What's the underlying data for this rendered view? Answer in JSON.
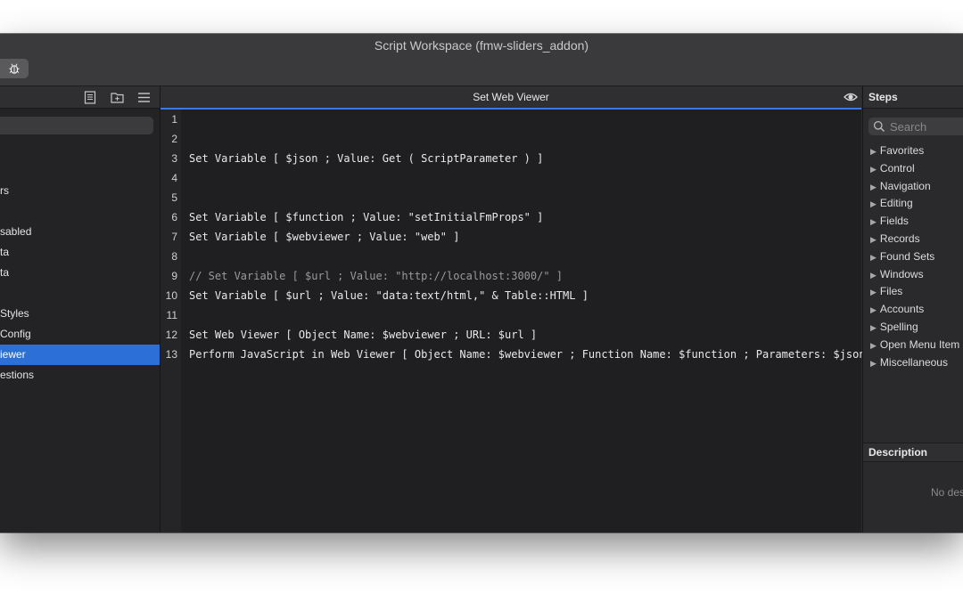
{
  "window": {
    "title": "Script Workspace (fmw-sliders_addon)"
  },
  "toolbar": {
    "debug_icon": "bug-icon"
  },
  "scripts_pane": {
    "search_placeholder": "",
    "items": [
      {
        "label": ""
      },
      {
        "label": ""
      },
      {
        "label": "rs"
      },
      {
        "label": ""
      },
      {
        "label": "sabled"
      },
      {
        "label": "ta"
      },
      {
        "label": "ta"
      },
      {
        "label": ""
      },
      {
        "label": "Styles"
      },
      {
        "label": "Config"
      },
      {
        "label": "iewer",
        "selected": true
      },
      {
        "label": "estions"
      }
    ]
  },
  "editor": {
    "title": "Set Web Viewer",
    "lines": [
      {
        "no": "1",
        "text": ""
      },
      {
        "no": "2",
        "text": ""
      },
      {
        "no": "3",
        "text": "Set Variable [ $json ; Value: Get ( ScriptParameter ) ]"
      },
      {
        "no": "4",
        "text": ""
      },
      {
        "no": "5",
        "text": ""
      },
      {
        "no": "6",
        "text": "Set Variable [ $function ; Value: \"setInitialFmProps\" ]"
      },
      {
        "no": "7",
        "text": "Set Variable [ $webviewer ; Value: \"web\" ]"
      },
      {
        "no": "8",
        "text": ""
      },
      {
        "no": "9",
        "text": "// Set Variable [ $url ; Value: \"http://localhost:3000/\" ]",
        "comment": true
      },
      {
        "no": "10",
        "text": "Set Variable [ $url ; Value: \"data:text/html,\" & Table::HTML ]"
      },
      {
        "no": "11",
        "text": ""
      },
      {
        "no": "12",
        "text": "Set Web Viewer [ Object Name: $webviewer ; URL: $url ]"
      },
      {
        "no": "13",
        "text": "Perform JavaScript in Web Viewer [ Object Name: $webviewer ; Function Name: $function ; Parameters: $json ]"
      }
    ]
  },
  "steps_pane": {
    "title": "Steps",
    "search_placeholder": "Search",
    "categories": [
      "Favorites",
      "Control",
      "Navigation",
      "Editing",
      "Fields",
      "Records",
      "Found Sets",
      "Windows",
      "Files",
      "Accounts",
      "Spelling",
      "Open Menu Item",
      "Miscellaneous"
    ],
    "description_title": "Description",
    "description_empty": "No des"
  },
  "colors": {
    "selection": "#2c6fd6",
    "editor_bg": "#1f1f21",
    "accent_line": "#3b7be0"
  }
}
